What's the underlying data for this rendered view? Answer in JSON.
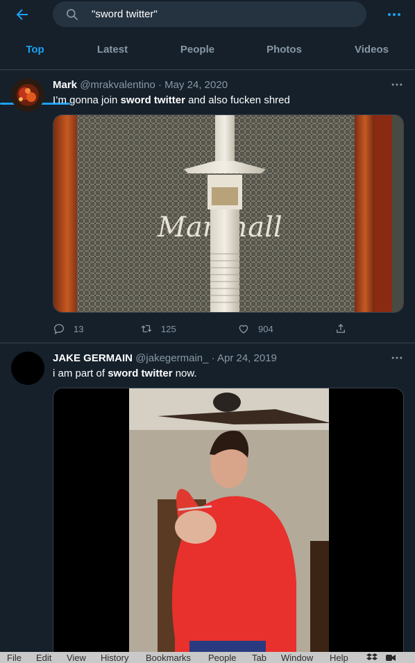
{
  "search": {
    "query": "\"sword twitter\""
  },
  "tabs": [
    {
      "label": "Top"
    },
    {
      "label": "Latest"
    },
    {
      "label": "People"
    },
    {
      "label": "Photos"
    },
    {
      "label": "Videos"
    }
  ],
  "active_tab": "Top",
  "tweets": [
    {
      "name": "Mark",
      "handle": "@mrakvalentino",
      "separator": "·",
      "date": "May 24, 2020",
      "text_before": "I’m gonna join ",
      "text_bold": "sword twitter",
      "text_after": " and also fucken shred",
      "media_text": "Marshall",
      "replies": "13",
      "retweets": "125",
      "likes": "904"
    },
    {
      "name": "JAKE GERMAIN",
      "handle": "@jakegermain_",
      "separator": "·",
      "date": "Apr 24, 2019",
      "text_before": "i am part of ",
      "text_bold": "sword twitter",
      "text_after": " now."
    }
  ],
  "menubar": {
    "items": [
      "File",
      "Edit",
      "View",
      "History",
      "Bookmarks",
      "People",
      "Tab",
      "Window",
      "Help"
    ]
  },
  "colors": {
    "background": "#15202b",
    "accent": "#1da1f2",
    "secondary_text": "#8899a6",
    "border": "#38444d"
  },
  "icons": [
    "back-arrow-icon",
    "search-icon",
    "more-icon",
    "reply-icon",
    "retweet-icon",
    "like-icon",
    "share-icon",
    "dropbox-icon",
    "facetime-icon"
  ]
}
